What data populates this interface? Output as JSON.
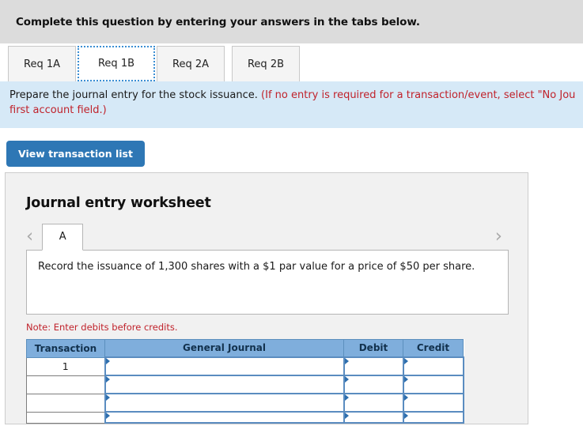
{
  "header": {
    "instruction": "Complete this question by entering your answers in the tabs below."
  },
  "req_tabs": [
    {
      "label": "Req 1A",
      "active": false
    },
    {
      "label": "Req 1B",
      "active": true
    },
    {
      "label": "Req 2A",
      "active": false
    },
    {
      "label": "Req 2B",
      "active": false
    }
  ],
  "prompt": {
    "main": "Prepare the journal entry for the stock issuance.",
    "red_line1": "(If no entry is required for a transaction/event, select \"No Jou",
    "red_line2": "first account field.)"
  },
  "toolbar": {
    "view_transaction_list_label": "View transaction list"
  },
  "worksheet": {
    "title": "Journal entry worksheet",
    "prev_chevron": "‹",
    "next_chevron": "›",
    "entry_tabs": [
      {
        "label": "A",
        "active": true
      }
    ],
    "description": "Record the issuance of 1,300 shares with a $1 par value for a price of $50 per share.",
    "note": "Note: Enter debits before credits.",
    "table": {
      "columns": [
        "Transaction",
        "General Journal",
        "Debit",
        "Credit"
      ],
      "rows": [
        {
          "transaction": "1",
          "general_journal": "",
          "debit": "",
          "credit": ""
        },
        {
          "transaction": "",
          "general_journal": "",
          "debit": "",
          "credit": ""
        },
        {
          "transaction": "",
          "general_journal": "",
          "debit": "",
          "credit": ""
        },
        {
          "transaction": "",
          "general_journal": "",
          "debit": "",
          "credit": ""
        }
      ]
    }
  },
  "colors": {
    "header_band": "#dcdcdc",
    "prompt_band": "#d6e9f7",
    "accent_blue": "#2e77b5",
    "table_header_blue": "#7faedc",
    "alert_red": "#c0222b",
    "input_border": "#5a8cc0"
  }
}
